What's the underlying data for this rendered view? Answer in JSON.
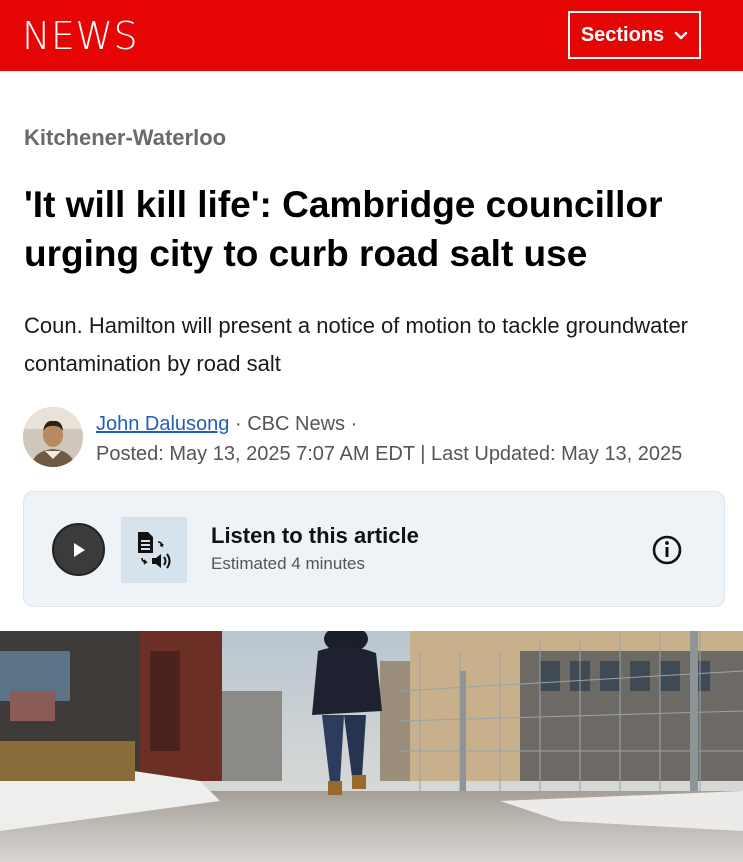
{
  "header": {
    "logo": "NEWS",
    "sections_label": "Sections",
    "brand_color": "#e60505"
  },
  "article": {
    "region": "Kitchener-Waterloo",
    "headline": "'It will kill life': Cambridge councillor urging city to curb road salt use",
    "deck": "Coun. Hamilton will present a notice of motion to tackle groundwater contamination by road salt",
    "author": "John Dalusong",
    "outlet": "· CBC News ·",
    "dates": "Posted: May 13, 2025 7:07 AM EDT | Last Updated: May 13, 2025"
  },
  "audio": {
    "title": "Listen to this article",
    "subtitle": "Estimated 4 minutes"
  },
  "icons": [
    "chevron-down-icon",
    "play-icon",
    "text-to-speech-icon",
    "info-icon",
    "author-avatar"
  ]
}
